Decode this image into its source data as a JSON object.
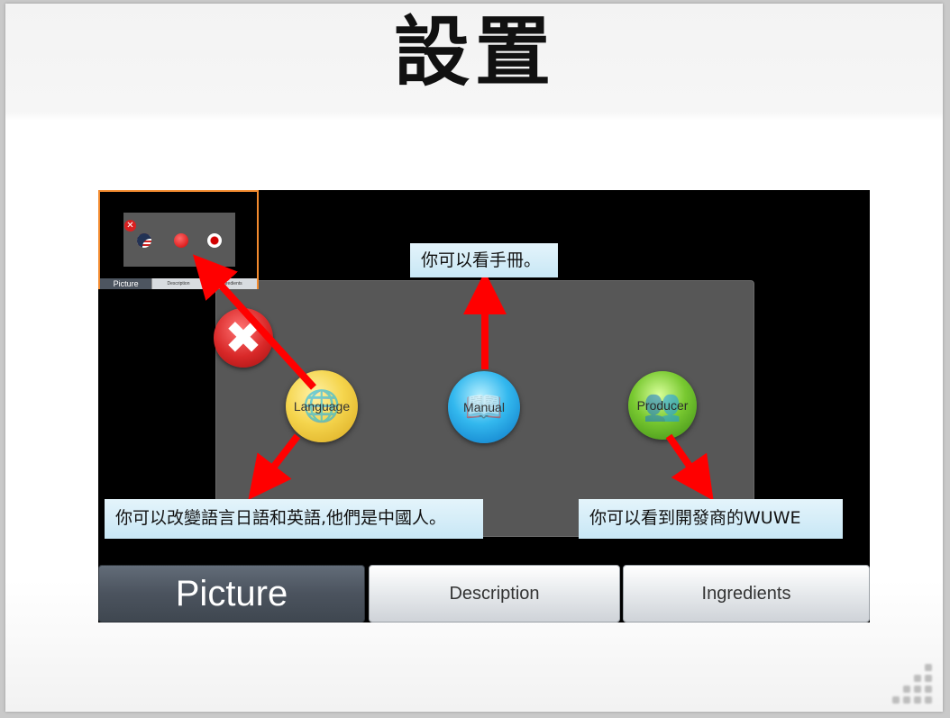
{
  "slide": {
    "title": "設置"
  },
  "app": {
    "tabs": [
      {
        "label": "Picture",
        "active": true
      },
      {
        "label": "Description",
        "active": false
      },
      {
        "label": "Ingredients",
        "active": false
      }
    ],
    "buttons": {
      "language": "Language",
      "manual": "Manual",
      "producer": "Producer"
    }
  },
  "thumbnail": {
    "tabs": [
      "Picture",
      "Description",
      "Ingredients"
    ],
    "flags": [
      "us-flag-icon",
      "china-flag-icon",
      "japan-flag-icon"
    ]
  },
  "callouts": {
    "manual": "你可以看手冊。",
    "language": "你可以改變語言日語和英語,他們是中國人。",
    "producer": "你可以看到開發商的WUWE"
  },
  "colors": {
    "arrow": "#ff0000",
    "thumb_border": "#f28a2e",
    "callout_bg": "#d6eef8"
  }
}
